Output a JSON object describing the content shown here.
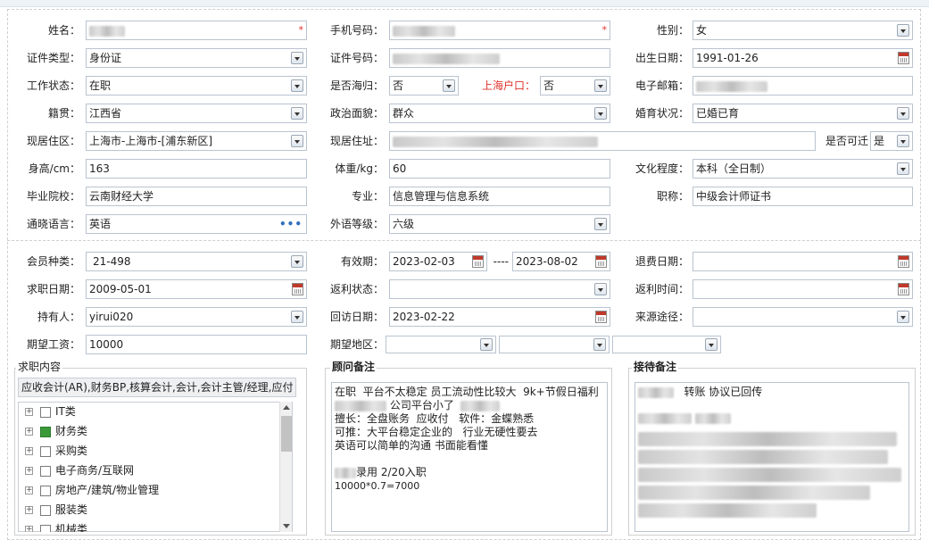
{
  "personal": {
    "name_label": "姓名：",
    "phone_label": "手机号码：",
    "gender_label": "性别：",
    "gender_value": "女",
    "id_type_label": "证件类型：",
    "id_type_value": "身份证",
    "id_no_label": "证件号码：",
    "birth_label": "出生日期：",
    "birth_value": "1991-01-26",
    "work_status_label": "工作状态：",
    "work_status_value": "在职",
    "overseas_label": "是否海归：",
    "overseas_value": "否",
    "shanghai_hukou_label": "上海户口：",
    "shanghai_hukou_value": "否",
    "email_label": "电子邮箱：",
    "native_label": "籍贯：",
    "native_value": "江西省",
    "political_label": "政治面貌：",
    "political_value": "群众",
    "marital_label": "婚育状况：",
    "marital_value": "已婚已育",
    "residence_area_label": "现居住区：",
    "residence_area_value": "上海市-上海市-[浦东新区]",
    "address_label": "现居住址：",
    "relocate_label": "是否可迁",
    "relocate_value": "是",
    "height_label": "身高/cm：",
    "height_value": "163",
    "weight_label": "体重/kg：",
    "weight_value": "60",
    "education_label": "文化程度：",
    "education_value": "本科（全日制）",
    "school_label": "毕业院校：",
    "school_value": "云南财经大学",
    "major_label": "专业：",
    "major_value": "信息管理与信息系统",
    "title_label": "职称：",
    "title_value": "中级会计师证书",
    "language_label": "通晓语言：",
    "language_value": "英语",
    "lang_level_label": "外语等级：",
    "lang_level_value": "六级"
  },
  "membership": {
    "member_type_label": "会员种类：",
    "member_type_value": "21-498",
    "valid_label": "有效期：",
    "valid_from": "2023-02-03",
    "valid_sep": "----",
    "valid_to": "2023-08-02",
    "refund_date_label": "退费日期：",
    "job_date_label": "求职日期：",
    "job_date_value": "2009-05-01",
    "rebate_status_label": "返利状态：",
    "rebate_time_label": "返利时间：",
    "holder_label": "持有人：",
    "holder_value": "yirui020",
    "visit_date_label": "回访日期：",
    "visit_date_value": "2023-02-22",
    "source_label": "来源途径：",
    "salary_label": "期望工资：",
    "salary_value": "10000",
    "area_label": "期望地区："
  },
  "job_content": {
    "title": "求职内容",
    "selected": "应收会计(AR),财务BP,核算会计,会计,会计主管/经理,应付",
    "tree": [
      {
        "label": "IT类",
        "checked": false
      },
      {
        "label": "财务类",
        "checked": true
      },
      {
        "label": "采购类",
        "checked": false
      },
      {
        "label": "电子商务/互联网",
        "checked": false
      },
      {
        "label": "房地产/建筑/物业管理",
        "checked": false
      },
      {
        "label": "服装类",
        "checked": false
      },
      {
        "label": "机械类",
        "checked": false
      }
    ]
  },
  "advisor_notes": {
    "title": "顾问备注",
    "line1": "在职  平台不太稳定 员工流动性比较大  9k+节假日福利",
    "line2": "公司平台小了",
    "line3": "擅长：全盘账务  应收付   软件：金蝶熟悉",
    "line4": "可推：大平台稳定企业的   行业无硬性要去",
    "line5": "英语可以简单的沟通 书面能看懂",
    "line6": "录用 2/20入职",
    "line7": "10000*0.7=7000"
  },
  "reception_notes": {
    "title": "接待备注",
    "line1": "转账 协议已回传"
  },
  "icons": {
    "dropdown": "chevron-down-icon",
    "calendar": "calendar-icon",
    "required": "asterisk-icon",
    "more": "ellipsis-icon",
    "expand": "plus-icon",
    "checkbox": "checkbox-icon"
  }
}
